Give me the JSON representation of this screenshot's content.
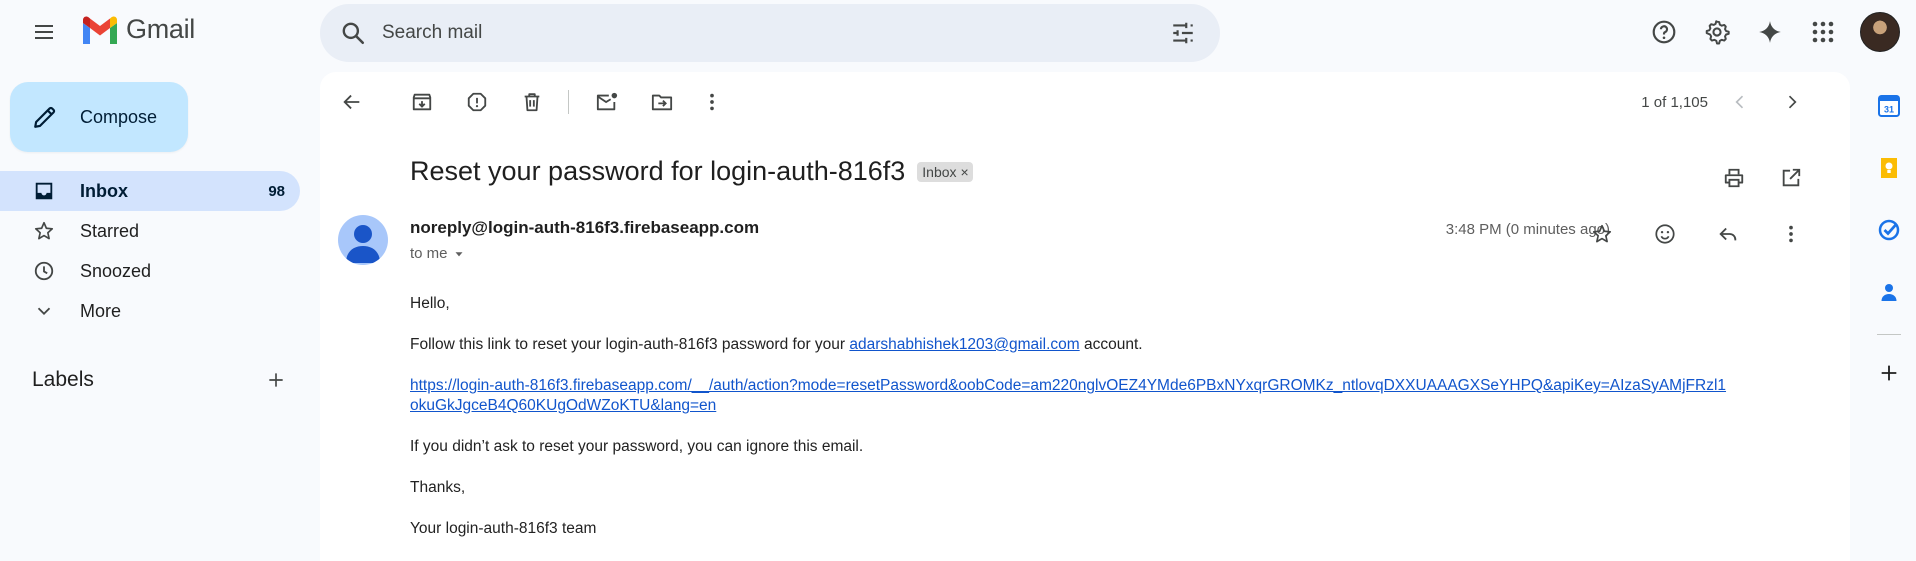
{
  "app": {
    "name": "Gmail"
  },
  "search": {
    "placeholder": "Search mail"
  },
  "nav": {
    "compose_label": "Compose",
    "items": [
      {
        "label": "Inbox",
        "count": "98"
      },
      {
        "label": "Starred"
      },
      {
        "label": "Snoozed"
      },
      {
        "label": "More"
      }
    ],
    "labels_heading": "Labels"
  },
  "toolbar": {
    "pager": "1 of 1,105"
  },
  "email": {
    "subject": "Reset your password for login-auth-816f3",
    "label_chip": "Inbox",
    "chip_close": "×",
    "sender": "noreply@login-auth-816f3.firebaseapp.com",
    "recipient": "to me",
    "time": "3:48 PM (0 minutes ago)",
    "body": {
      "greeting": "Hello,",
      "line1_before": "Follow this link to reset your login-auth-816f3 password for your ",
      "line1_email": "adarshabhishek1203@gmail.com",
      "line1_after": " account.",
      "reset_link": "https://login-auth-816f3.firebaseapp.com/__/auth/action?mode=resetPassword&oobCode=am220nglvOEZ4YMde6PBxNYxqrGROMKz_ntlovqDXXUAAAGXSeYHPQ&apiKey=AIzaSyAMjFRzl1okuGkJgceB4Q60KUgOdWZoKTU&lang=en",
      "ignore": "If you didn’t ask to reset your password, you can ignore this email.",
      "thanks": "Thanks,",
      "signature": "Your login-auth-816f3 team"
    }
  },
  "colors": {
    "background": "#f8fafd",
    "compose": "#c2e7ff",
    "active_nav": "#d3e3fd",
    "search": "#e9eef6",
    "link": "#1155cc"
  },
  "icons": [
    "menu-icon",
    "gmail-logo",
    "search-icon",
    "tune-icon",
    "help-icon",
    "settings-icon",
    "gemini-icon",
    "apps-icon",
    "back-icon",
    "archive-icon",
    "report-spam-icon",
    "delete-icon",
    "mark-unread-icon",
    "move-to-icon",
    "more-vert-icon",
    "chevron-left-icon",
    "chevron-right-icon",
    "print-icon",
    "open-new-window-icon",
    "star-icon",
    "emoji-icon",
    "reply-icon",
    "calendar-icon",
    "keep-icon",
    "tasks-icon",
    "contacts-icon",
    "add-icon"
  ]
}
